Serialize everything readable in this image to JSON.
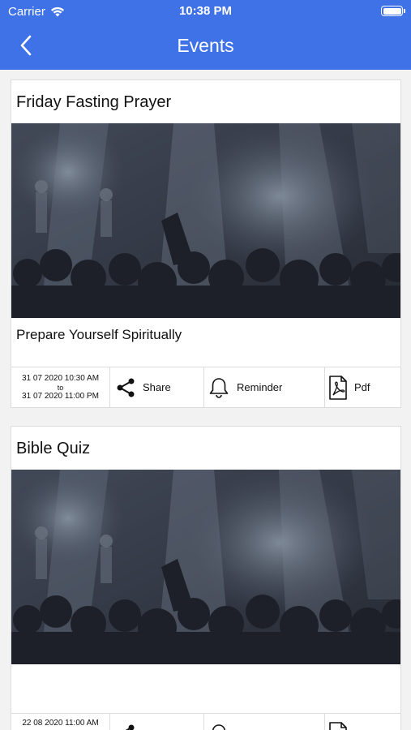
{
  "status_bar": {
    "carrier": "Carrier",
    "time": "10:38 PM"
  },
  "nav": {
    "title": "Events"
  },
  "events": [
    {
      "title": "Friday Fasting Prayer",
      "description": "Prepare Yourself Spiritually",
      "start": "31 07 2020 10:30 AM",
      "to_label": "to",
      "end": "31 07 2020 11:00 PM",
      "share_label": "Share",
      "reminder_label": "Reminder",
      "pdf_label": "Pdf"
    },
    {
      "title": "Bible Quiz",
      "description": "",
      "start": "22 08 2020 11:00 AM",
      "to_label": "",
      "end": "",
      "share_label": "",
      "reminder_label": "",
      "pdf_label": ""
    }
  ],
  "icons": [
    "back-chevron-icon",
    "wifi-icon",
    "battery-icon",
    "share-icon",
    "bell-icon",
    "pdf-icon"
  ],
  "colors": {
    "nav_background": "#3f72e6",
    "page_background": "#f2f2f2"
  }
}
